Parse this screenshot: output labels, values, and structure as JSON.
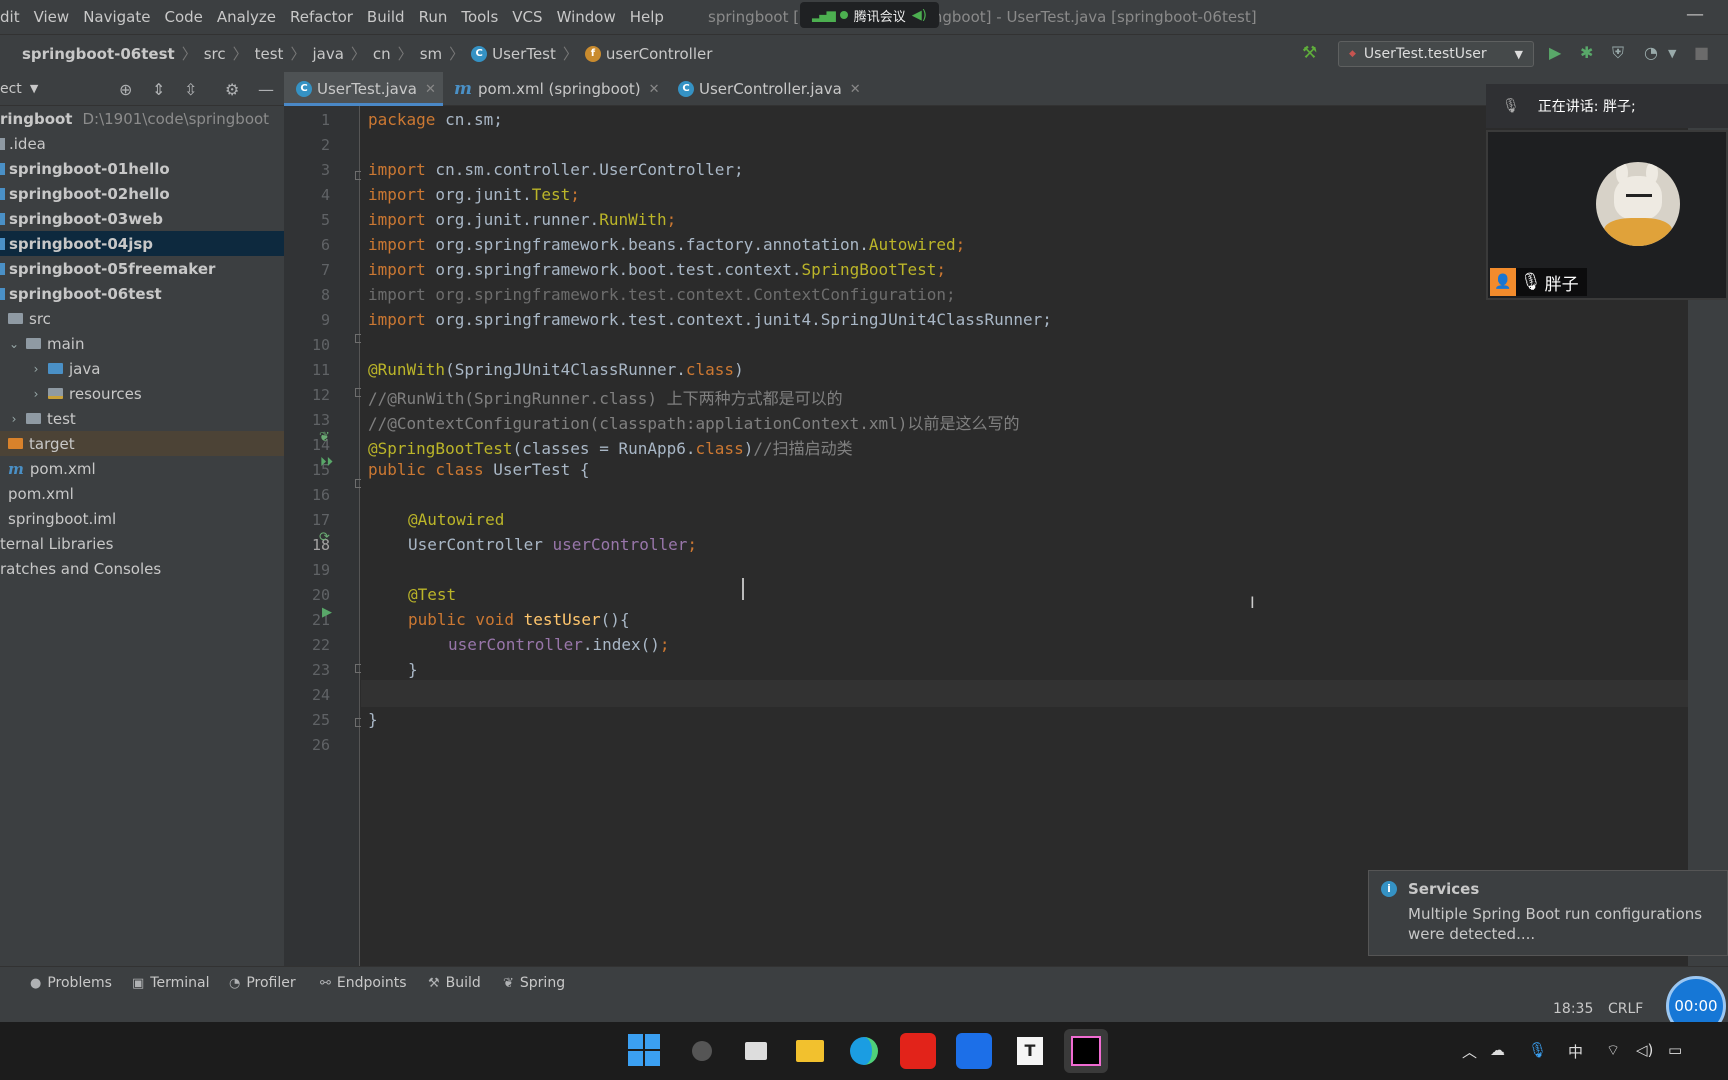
{
  "menubar": {
    "items": [
      "dit",
      "View",
      "Navigate",
      "Code",
      "Analyze",
      "Refactor",
      "Build",
      "Run",
      "Tools",
      "VCS",
      "Window",
      "Help"
    ],
    "window_title": "springboot [D:\\1901\\code\\springboot] - UserTest.java [springboot-06test]",
    "meeting_label": "腾讯会议"
  },
  "navbar": {
    "breadcrumbs": [
      "springboot-06test",
      "src",
      "test",
      "java",
      "cn",
      "sm",
      "UserTest",
      "userController"
    ],
    "run_config": "UserTest.testUser"
  },
  "project_panel": {
    "title": "ect",
    "tree": [
      {
        "label": "ringboot",
        "path": "D:\\1901\\code\\springboot",
        "bold": true
      },
      {
        "label": ".idea"
      },
      {
        "label": "springboot-01hello",
        "bold": true
      },
      {
        "label": "springboot-02hello",
        "bold": true
      },
      {
        "label": "springboot-03web",
        "bold": true
      },
      {
        "label": "springboot-04jsp",
        "bold": true
      },
      {
        "label": "springboot-05freemaker",
        "bold": true
      },
      {
        "label": "springboot-06test",
        "bold": true
      },
      {
        "label": "src"
      },
      {
        "label": "main"
      },
      {
        "label": "java"
      },
      {
        "label": "resources"
      },
      {
        "label": "test"
      },
      {
        "label": "target"
      },
      {
        "label": "pom.xml"
      },
      {
        "label": "pom.xml"
      },
      {
        "label": "springboot.iml"
      },
      {
        "label": "ternal Libraries"
      },
      {
        "label": "ratches and Consoles"
      }
    ]
  },
  "tabs": [
    {
      "label": "UserTest.java",
      "active": true
    },
    {
      "label": "pom.xml (springboot)",
      "active": false
    },
    {
      "label": "UserController.java",
      "active": false
    }
  ],
  "editor": {
    "current_line": 18,
    "line_numbers": [
      "1",
      "2",
      "3",
      "4",
      "5",
      "6",
      "7",
      "8",
      "9",
      "10",
      "11",
      "12",
      "13",
      "14",
      "15",
      "16",
      "17",
      "18",
      "19",
      "20",
      "21",
      "22",
      "23",
      "24",
      "25",
      "26"
    ],
    "code": {
      "l1_kw": "package",
      "l1_rest": " cn.sm;",
      "imp": "import",
      "l3_rest": " cn.sm.controller.UserController;",
      "l4_pre": " org.junit.",
      "l4_ann": "Test",
      "l5_pre": " org.junit.runner.",
      "l5_ann": "RunWith",
      "l6_pre": " org.springframework.beans.factory.annotation.",
      "l6_ann": "Autowired",
      "l7_pre": " org.springframework.boot.test.context.",
      "l7_ann": "SpringBootTest",
      "l8_full": "import org.springframework.test.context.ContextConfiguration;",
      "l9_rest": " org.springframework.test.context.junit4.SpringJUnit4ClassRunner;",
      "l11_ann": "@RunWith",
      "l11_rest": "(SpringJUnit4ClassRunner.",
      "l11_kw": "class",
      "l11_end": ")",
      "l12": "//@RunWith(SpringRunner.class) 上下两种方式都是可以的",
      "l13": "//@ContextConfiguration(classpath:appliationContext.xml)以前是这么写的",
      "l14_ann": "@SpringBootTest",
      "l14_rest": "(classes = RunApp6.",
      "l14_kw": "class",
      "l14_close": ")",
      "l14_cmt": "//扫描启动类",
      "l15_kw": "public class",
      "l15_rest": " UserTest {",
      "l17_ann": "@Autowired",
      "l18_type": "UserController ",
      "l18_field": "userController",
      "l18_semi": ";",
      "l20_ann": "@Test",
      "l21_kw": "public void",
      "l21_mth": " testUser",
      "l21_rest": "(){",
      "l22_field": "userController",
      "l22_rest": ".index()",
      "l22_semi": ";",
      "l23": "}",
      "l25": "}"
    }
  },
  "meeting": {
    "speaking": "正在讲话: 胖子;",
    "participant": "胖子"
  },
  "notification": {
    "title": "Services",
    "body": "Multiple Spring Boot run configurations were detected...."
  },
  "toolwindows": [
    "Problems",
    "Terminal",
    "Profiler",
    "Endpoints",
    "Build",
    "Spring"
  ],
  "status": {
    "position": "18:35",
    "line_sep": "CRLF",
    "timer": "00:00"
  },
  "tray": {
    "ime": "中"
  },
  "colors": {
    "keyword": "#cc7832",
    "annotation": "#bbb529",
    "comment": "#808080",
    "field": "#9876aa",
    "method": "#ffc66d",
    "selection": "#0d293e",
    "accent": "#4a88c7"
  }
}
